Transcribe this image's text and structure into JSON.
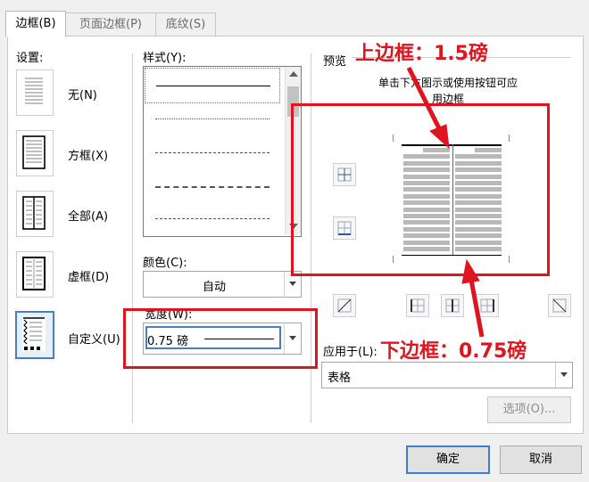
{
  "tabs": [
    {
      "label": "边框(B)"
    },
    {
      "label": "页面边框(P)"
    },
    {
      "label": "底纹(S)"
    }
  ],
  "settings": {
    "title": "设置:",
    "items": [
      {
        "label": "无(N)"
      },
      {
        "label": "方框(X)"
      },
      {
        "label": "全部(A)"
      },
      {
        "label": "虚框(D)"
      },
      {
        "label": "自定义(U)"
      }
    ]
  },
  "style": {
    "label": "样式(Y):"
  },
  "color": {
    "label": "颜色(C):",
    "value": "自动"
  },
  "width": {
    "label": "宽度(W):",
    "value": "0.75 磅"
  },
  "preview": {
    "title": "预览",
    "hint_line1": "单击下方图示或使用按钮可应",
    "hint_line2": "用边框"
  },
  "apply": {
    "label": "应用于(L):",
    "value": "表格"
  },
  "buttons": {
    "options": "选项(O)...",
    "ok": "确定",
    "cancel": "取消"
  },
  "annotations": {
    "top": "上边框：1.5磅",
    "bottom": "下边框：0.75磅"
  },
  "colors": {
    "annotation": "#e0141e",
    "selected_border": "#4a7fc6"
  }
}
